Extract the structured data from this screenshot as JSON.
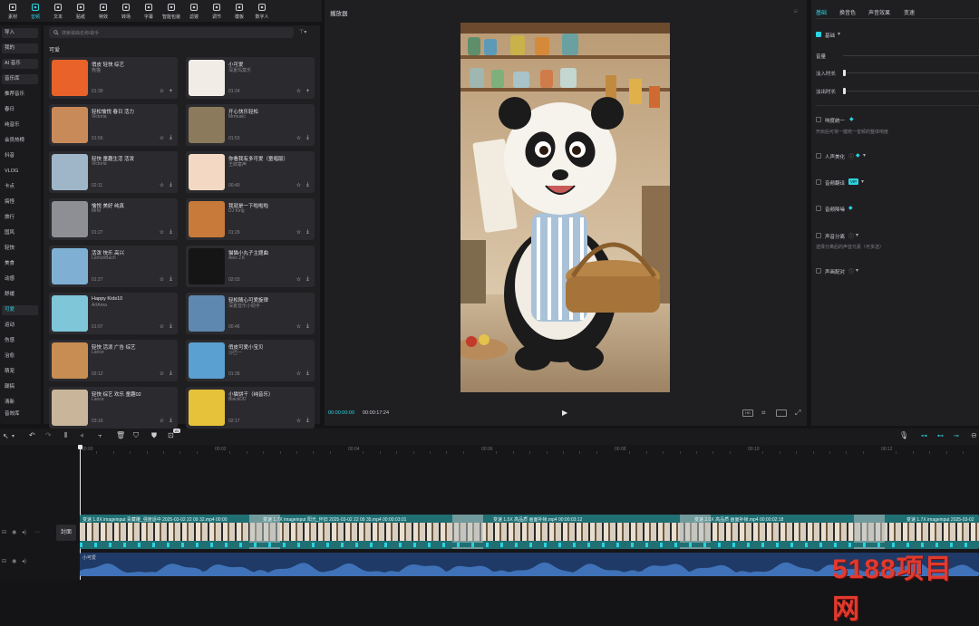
{
  "toolbar": {
    "tools": [
      {
        "label": "素材",
        "icon": "media-icon"
      },
      {
        "label": "音频",
        "icon": "audio-icon"
      },
      {
        "label": "文本",
        "icon": "text-icon"
      },
      {
        "label": "贴纸",
        "icon": "sticker-icon"
      },
      {
        "label": "特效",
        "icon": "effects-icon"
      },
      {
        "label": "转场",
        "icon": "transition-icon"
      },
      {
        "label": "字幕",
        "icon": "caption-icon"
      },
      {
        "label": "智能包装",
        "icon": "smart-pack-icon"
      },
      {
        "label": "滤镜",
        "icon": "filter-icon"
      },
      {
        "label": "调节",
        "icon": "adjust-icon"
      },
      {
        "label": "模板",
        "icon": "template-icon"
      },
      {
        "label": "数字人",
        "icon": "avatar-icon"
      }
    ],
    "active_index": 1
  },
  "categories": {
    "items": [
      "导入",
      "我的",
      "AI 音乐",
      "音乐库",
      "推荐音乐",
      "春日",
      "纯音乐",
      "会员热榜",
      "抖音",
      "VLOG",
      "卡点",
      "搞怪",
      "旅行",
      "国风",
      "轻快",
      "美食",
      "动感",
      "舒缓",
      "可爱",
      "运动",
      "伤感",
      "治愈",
      "萌宠",
      "颠搞",
      "清新",
      "音效库"
    ],
    "selected": "可爱"
  },
  "music": {
    "search_placeholder": "搜索歌曲名称/歌手",
    "section_title": "可爱",
    "tracks": [
      {
        "title": "俏皮 轻快 综艺",
        "artist": "熊猫",
        "duration": "01:39",
        "thumb": "#e8622a"
      },
      {
        "title": "小可爱",
        "artist": "深夏玛莫乐",
        "duration": "01:24",
        "thumb": "#f1ece6"
      },
      {
        "title": "轻松愉悦 春日 活力",
        "artist": "Victoria",
        "duration": "01:56",
        "thumb": "#c98a5a"
      },
      {
        "title": "开心快乐轻松",
        "artist": "Mrmusic",
        "duration": "01:53",
        "thumb": "#8c7a5c"
      },
      {
        "title": "轻快 童趣生活 活泼",
        "artist": "Victoria",
        "duration": "02:11",
        "thumb": "#9fb6c9"
      },
      {
        "title": "你看我有多可爱（童唱版）",
        "artist": "王郎童声",
        "duration": "00:40",
        "thumb": "#f3d9c4"
      },
      {
        "title": "愉悦 美好 纯真",
        "artist": "MrM",
        "duration": "01:27",
        "thumb": "#8e8f95"
      },
      {
        "title": "我就是一下啦啦啦",
        "artist": "DJ King",
        "duration": "01:29",
        "thumb": "#c77a3a"
      },
      {
        "title": "活泼 快乐 高兴",
        "artist": "LemonBach",
        "duration": "01:27",
        "thumb": "#7fb0d4"
      },
      {
        "title": "猫猫小丸子主题曲",
        "artist": "Alex J.K",
        "duration": "02:03",
        "thumb": "#151515"
      },
      {
        "title": "Happy Kids10",
        "artist": "ArtArea",
        "duration": "01:07",
        "thumb": "#7ec6d8"
      },
      {
        "title": "轻松随心可爱旋律",
        "artist": "深夏音乐小助手",
        "duration": "00:46",
        "thumb": "#5e88b0"
      },
      {
        "title": "轻快 活泼 广告 综艺",
        "artist": "Lance",
        "duration": "02:12",
        "thumb": "#c88d52"
      },
      {
        "title": "俏皮可爱小宝贝",
        "artist": "沙巴一",
        "duration": "01:39",
        "thumb": "#5aa0d0"
      },
      {
        "title": "轻快 综艺 欢乐 童趣02",
        "artist": "Lance",
        "duration": "03:16",
        "thumb": "#c9b59a"
      },
      {
        "title": "小猫饼干（纯音乐）",
        "artist": "BlackDD",
        "duration": "02:17",
        "thumb": "#e6c23a"
      }
    ]
  },
  "player": {
    "title": "播放器",
    "current_time": "00:00:00:00",
    "total_time": "00:00:17:24"
  },
  "right_panel": {
    "tabs": [
      "基础",
      "换音色",
      "声音效果",
      "变速"
    ],
    "active_tab": 0,
    "basic_label": "基础",
    "volume_label": "音量",
    "fade_in_label": "淡入时长",
    "fade_out_label": "淡出时长",
    "loudness_label": "响度统一",
    "loudness_desc": "开启后可将一键统一音频的整体响度",
    "enhance_label": "人声美化",
    "denoise_label": "音频降噪",
    "translate_label": "音频翻译",
    "separate_label": "声音分离",
    "separate_desc": "选择分离后的声音元素（可多选）",
    "match_label": "声画配对",
    "vip_badge": "VIP"
  },
  "timeline": {
    "ticks": [
      "00:00",
      "00:02",
      "00:04",
      "00:06",
      "00:08",
      "00:10",
      "00:12"
    ],
    "cover_label": "封面",
    "clips": [
      "变速 1.8X  imageinput 青藏雕_强度适中 2025-03-02 22 09 32.mp4  00:00",
      "变速 1.7X  imageinput 阳光_怀旧 2025-03-02 22 09 35.mp4  00:00:03:01",
      "变速 1.5X  高品质 画面补帧.mp4  00:00:03:12",
      "变速 2.0X  高品质 画面补帧.mp4  00:00:02:18",
      "变速 1.7X  imageinput 2025-03-02"
    ],
    "audio_label": "小可爱",
    "ai_badge": "AI"
  },
  "colors": {
    "accent": "#2ad3e0",
    "video_track": "#1f6f73",
    "audio_track": "#1f3a66"
  },
  "watermark": "5188项目网"
}
